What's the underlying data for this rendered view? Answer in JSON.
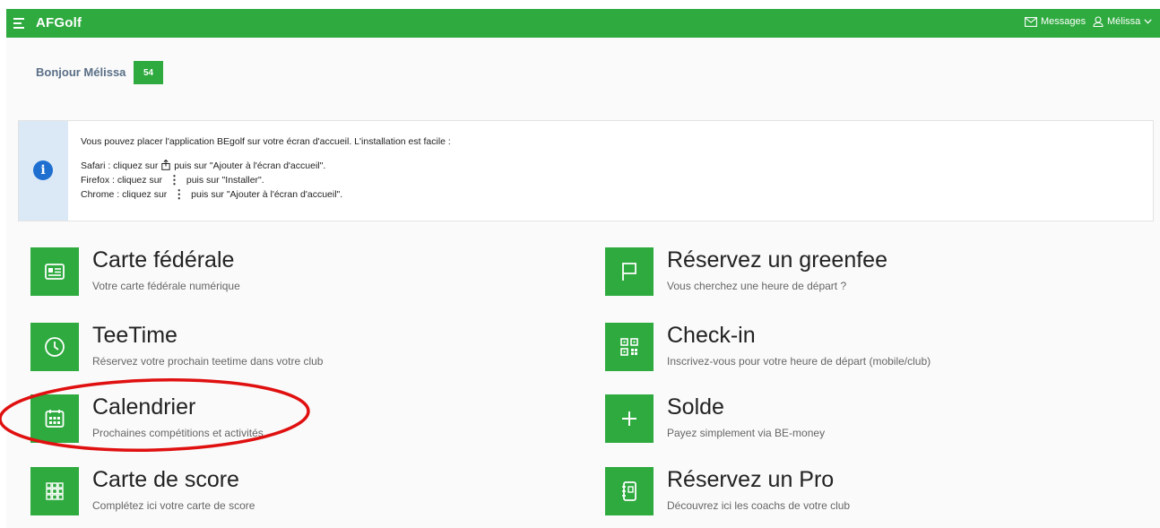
{
  "header": {
    "app_title": "AFGolf",
    "messages_label": "Messages",
    "user_label": "Mélissa"
  },
  "greeting": {
    "text": "Bonjour Mélissa",
    "badge": "54"
  },
  "info": {
    "intro": "Vous pouvez placer l'application BEgolf sur votre écran d'accueil. L'installation est facile :",
    "safari_before": "Safari : cliquez sur",
    "safari_after": "puis sur \"Ajouter à l'écran d'accueil\".",
    "firefox_before": "Firefox : cliquez sur",
    "firefox_after": "puis sur \"Installer\".",
    "chrome_before": "Chrome : cliquez sur",
    "chrome_after": "puis sur \"Ajouter à l'écran d'accueil\".",
    "dots_glyph": "⋮"
  },
  "tiles": [
    {
      "title": "Carte fédérale",
      "subtitle": "Votre carte fédérale numérique",
      "icon": "id-card-icon"
    },
    {
      "title": "Réservez un greenfee",
      "subtitle": "Vous cherchez une heure de départ ?",
      "icon": "flag-icon"
    },
    {
      "title": "TeeTime",
      "subtitle": "Réservez votre prochain teetime dans votre club",
      "icon": "clock-icon"
    },
    {
      "title": "Check-in",
      "subtitle": "Inscrivez-vous pour votre heure de départ (mobile/club)",
      "icon": "qr-code-icon"
    },
    {
      "title": "Calendrier",
      "subtitle": "Prochaines compétitions et activités",
      "icon": "calendar-icon"
    },
    {
      "title": "Solde",
      "subtitle": "Payez simplement via BE-money",
      "icon": "plus-icon"
    },
    {
      "title": "Carte de score",
      "subtitle": "Complétez ici votre carte de score",
      "icon": "grid-icon"
    },
    {
      "title": "Réservez un Pro",
      "subtitle": "Découvrez ici les coachs de votre club",
      "icon": "notebook-icon"
    }
  ],
  "colors": {
    "brand": "#2eaa3f",
    "info_icon": "#1e6fd0",
    "info_side": "#dbe9f7",
    "annotation": "#e01010"
  }
}
